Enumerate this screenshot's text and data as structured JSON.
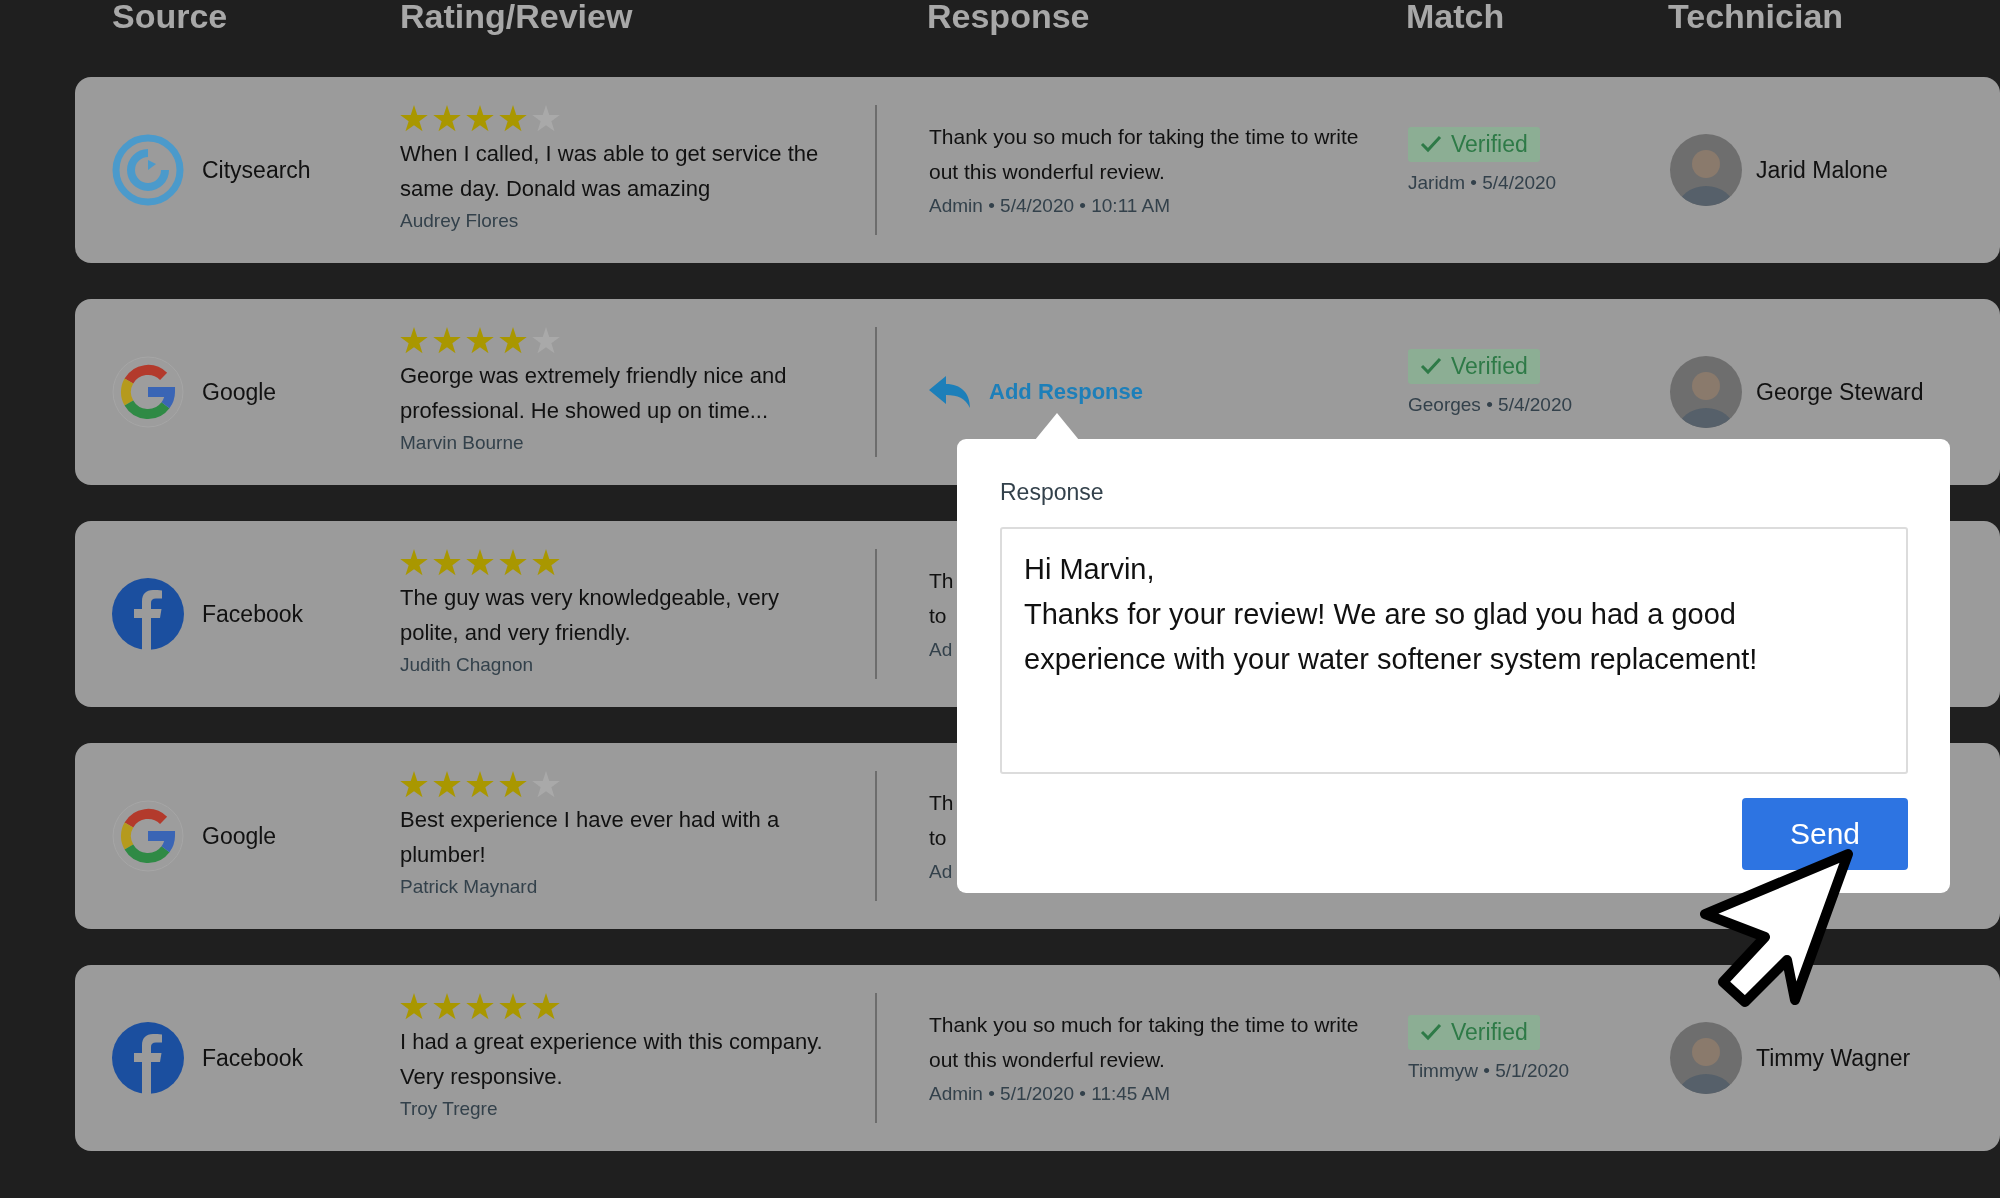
{
  "columns": [
    "Source",
    "Rating/Review",
    "Response",
    "Match",
    "Technician"
  ],
  "reviews": [
    {
      "source": {
        "kind": "citysearch",
        "name": "Citysearch"
      },
      "stars": 4,
      "review": "When I called, I was able to get service the same day. Donald was amazing",
      "reviewer": "Audrey Flores",
      "response": {
        "kind": "text",
        "text": "Thank you so much for taking the time to write out this wonderful review.",
        "meta": "Admin • 5/4/2020 • 10:11 AM"
      },
      "match": {
        "verified": true,
        "label": "Verified",
        "meta": "Jaridm • 5/4/2020"
      },
      "technician": "Jarid Malone"
    },
    {
      "source": {
        "kind": "google",
        "name": "Google"
      },
      "stars": 4,
      "review": "George was extremely friendly nice and professional. He showed up on time...",
      "reviewer": "Marvin Bourne",
      "response": {
        "kind": "add",
        "label": "Add Response"
      },
      "match": {
        "verified": true,
        "label": "Verified",
        "meta": "Georges • 5/4/2020"
      },
      "technician": "George Steward"
    },
    {
      "source": {
        "kind": "facebook",
        "name": "Facebook"
      },
      "stars": 5,
      "review": "The guy was very knowledgeable, very polite, and very friendly.",
      "reviewer": "Judith Chagnon",
      "response": {
        "kind": "text",
        "text": "Th\nto",
        "meta": "Ad"
      }
    },
    {
      "source": {
        "kind": "google",
        "name": "Google"
      },
      "stars": 4,
      "review": "Best experience I have ever had with a plumber!",
      "reviewer": "Patrick Maynard",
      "response": {
        "kind": "text",
        "text": "Th\nto",
        "meta": "Ad"
      }
    },
    {
      "source": {
        "kind": "facebook",
        "name": "Facebook"
      },
      "stars": 5,
      "review": "I had a great experience with this company. Very responsive.",
      "reviewer": "Troy Tregre",
      "response": {
        "kind": "text",
        "text": "Thank you so much for taking the time to write out this wonderful review.",
        "meta": "Admin • 5/1/2020 • 11:45 AM"
      },
      "match": {
        "verified": true,
        "label": "Verified",
        "meta": "Timmyw • 5/1/2020"
      },
      "technician": "Timmy Wagner"
    }
  ],
  "response_popup": {
    "label": "Response",
    "value": "Hi Marvin,\nThanks for your review! We are so glad you had a good experience with your water softener system replacement!",
    "button": "Send"
  }
}
